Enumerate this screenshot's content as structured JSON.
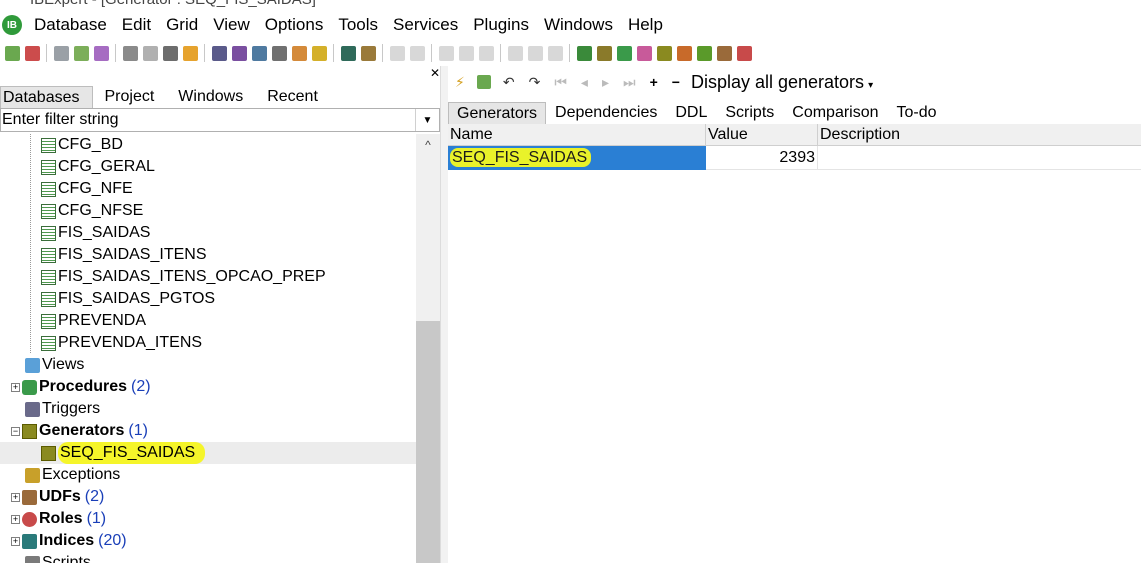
{
  "titlebar": {
    "text": "IBExpert - [Generator : SEQ_FIS_SAIDAS]"
  },
  "menu": {
    "items": [
      "Database",
      "Edit",
      "Grid",
      "View",
      "Options",
      "Tools",
      "Services",
      "Plugins",
      "Windows",
      "Help"
    ]
  },
  "left": {
    "tabs": [
      "Databases",
      "Project",
      "Windows",
      "Recent"
    ],
    "filter_placeholder": "Enter filter string",
    "tables": [
      "CFG_BD",
      "CFG_GERAL",
      "CFG_NFE",
      "CFG_NFSE",
      "FIS_SAIDAS",
      "FIS_SAIDAS_ITENS",
      "FIS_SAIDAS_ITENS_OPCAO_PREP",
      "FIS_SAIDAS_PGTOS",
      "PREVENDA",
      "PREVENDA_ITENS"
    ],
    "nodes": {
      "views": "Views",
      "procedures": "Procedures",
      "procedures_count": "(2)",
      "triggers": "Triggers",
      "generators": "Generators",
      "generators_count": "(1)",
      "generator_item": "SEQ_FIS_SAIDAS",
      "exceptions": "Exceptions",
      "udfs": "UDFs",
      "udfs_count": "(2)",
      "roles": "Roles",
      "roles_count": "(1)",
      "indices": "Indices",
      "indices_count": "(20)",
      "scripts": "Scripts"
    }
  },
  "right": {
    "display_label": "Display all generators",
    "tabs": [
      "Generators",
      "Dependencies",
      "DDL",
      "Scripts",
      "Comparison",
      "To-do"
    ],
    "columns": [
      "Name",
      "Value",
      "Description"
    ],
    "rows": [
      {
        "name": "SEQ_FIS_SAIDAS",
        "value": "2393",
        "description": ""
      }
    ]
  },
  "colors": {
    "selection_blue": "#2a7fd4",
    "highlight_yellow": "#f5f52a",
    "count_blue": "#1a3fb8"
  }
}
